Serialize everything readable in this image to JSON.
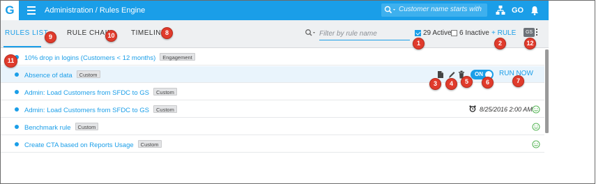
{
  "header": {
    "logo": "G",
    "breadcrumb": "Administration / Rules Engine",
    "search_placeholder": "Customer name starts with",
    "go_label": "GO"
  },
  "tabs": [
    {
      "label": "RULES LIST",
      "active": true
    },
    {
      "label": "RULE CHAIN",
      "active": false
    },
    {
      "label": "TIMELINE",
      "active": false
    }
  ],
  "toolbar": {
    "filter_placeholder": "Filter by rule name",
    "active_label": "29 Active",
    "active_checked": true,
    "inactive_label": "6 Inactive",
    "inactive_checked": false,
    "add_rule_label": "+ RULE",
    "gs_badge": "GS"
  },
  "rules": [
    {
      "name": "10% drop in logins (Customers < 12 months)",
      "tag": "Engagement",
      "status_icon": "",
      "schedule": ""
    },
    {
      "name": "Absence of data",
      "tag": "Custom",
      "selected": true,
      "toggle_label": "ON",
      "toggle_on": true,
      "run_now_label": "RUN NOW"
    },
    {
      "name": "Admin: Load Customers from SFDC to GS",
      "tag": "Custom",
      "status_icon": "",
      "schedule": ""
    },
    {
      "name": "Admin: Load Customers from SFDC to GS",
      "tag": "Custom",
      "status_icon": "smiley-icon",
      "schedule": "8/25/2016 2:00 AM"
    },
    {
      "name": "Benchmark rule",
      "tag": "Custom",
      "status_icon": "smiley-icon",
      "schedule": ""
    },
    {
      "name": "Create CTA based on Reports Usage",
      "tag": "Custom",
      "status_icon": "smiley-icon",
      "schedule": ""
    }
  ],
  "callouts": [
    "1",
    "2",
    "3",
    "4",
    "5",
    "6",
    "7",
    "8",
    "9",
    "10",
    "11",
    "12"
  ],
  "colors": {
    "accent": "#1a9ee8",
    "callout": "#e03b2c",
    "toolbar_bg": "#eef0f2",
    "status_ok": "#5cb85c"
  }
}
